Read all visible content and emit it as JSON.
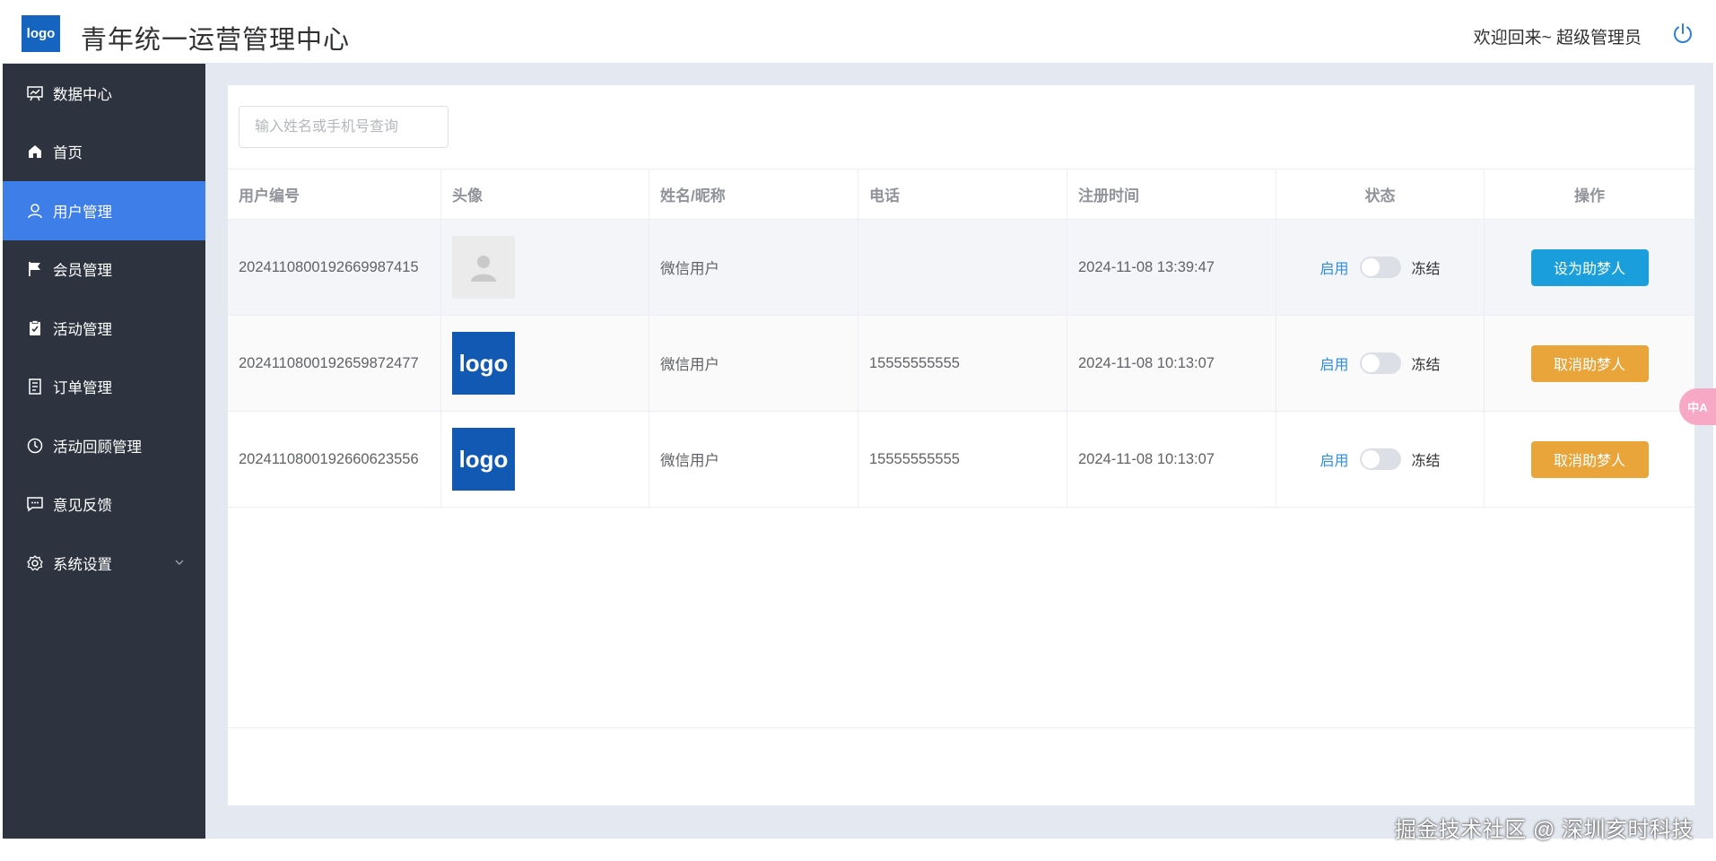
{
  "header": {
    "logo_text": "logo",
    "title": "青年统一运营管理中心",
    "welcome": "欢迎回来~ 超级管理员"
  },
  "sidebar": {
    "items": [
      {
        "label": "数据中心",
        "icon": "dashboard-icon"
      },
      {
        "label": "首页",
        "icon": "home-icon"
      },
      {
        "label": "用户管理",
        "icon": "user-icon",
        "active": true
      },
      {
        "label": "会员管理",
        "icon": "flag-icon"
      },
      {
        "label": "活动管理",
        "icon": "clipboard-icon"
      },
      {
        "label": "订单管理",
        "icon": "document-icon"
      },
      {
        "label": "活动回顾管理",
        "icon": "clock-icon"
      },
      {
        "label": "意见反馈",
        "icon": "chat-icon"
      },
      {
        "label": "系统设置",
        "icon": "gear-icon"
      }
    ]
  },
  "search": {
    "placeholder": "输入姓名或手机号查询",
    "value": ""
  },
  "table": {
    "columns": [
      "用户编号",
      "头像",
      "姓名/昵称",
      "电话",
      "注册时间",
      "状态",
      "操作"
    ],
    "rows": [
      {
        "id": "202411080019266998741 5",
        "avatar": "placeholder",
        "name": "微信用户",
        "phone": "",
        "registered": "2024-11-08 13:39:47",
        "status_on": "启用",
        "status_off": "冻结",
        "action": "设为助梦人"
      },
      {
        "id": "202411080019265987247 7",
        "avatar": "logo",
        "name": "微信用户",
        "phone": "15555555555",
        "registered": "2024-11-08 10:13:07",
        "status_on": "启用",
        "status_off": "冻结",
        "action": "取消助梦人"
      },
      {
        "id": "202411080019266062355 6",
        "avatar": "logo",
        "name": "微信用户",
        "phone": "15555555555",
        "registered": "2024-11-08 10:13:07",
        "status_on": "启用",
        "status_off": "冻结",
        "action": "取消助梦人"
      }
    ],
    "avatar_logo_text": "logo"
  },
  "colors": {
    "sidebar_bg": "#2d3440",
    "active_item": "#3d7ee8",
    "primary_button": "#1a9fdc",
    "warning_button": "#e9a43a"
  },
  "translate_badge": "中A",
  "watermark": "掘金技术社区 @ 深圳亥时科技"
}
